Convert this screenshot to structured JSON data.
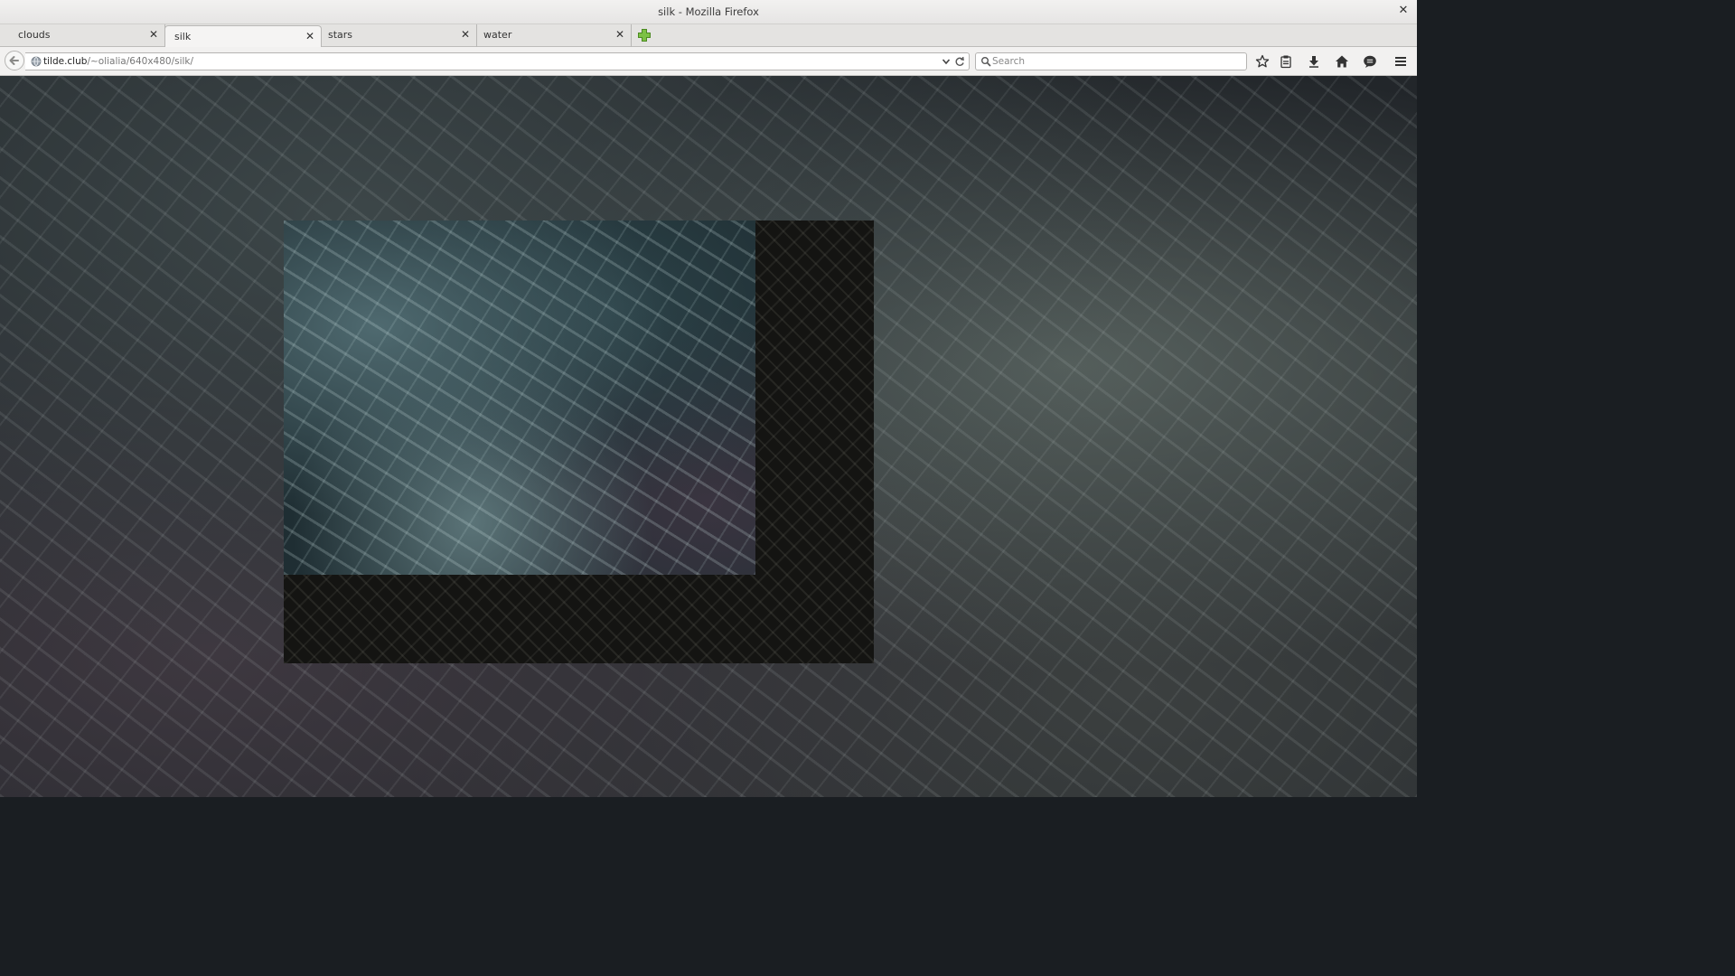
{
  "window": {
    "title": "silk - Mozilla Firefox"
  },
  "tabs": [
    {
      "label": "clouds"
    },
    {
      "label": "silk"
    },
    {
      "label": "stars"
    },
    {
      "label": "water"
    }
  ],
  "toolbar": {
    "url_host": "tilde.club",
    "url_path": "/~olialia/640x480/silk/",
    "search_placeholder": "Search"
  },
  "icons": {
    "back": "back-arrow-icon",
    "new_tab": "plus-icon",
    "bookmark": "star-icon",
    "reading_list": "clipboard-icon",
    "downloads": "download-arrow-icon",
    "home": "home-icon",
    "chat": "chat-bubble-icon",
    "menu": "hamburger-menu-icon"
  },
  "colors": {
    "new_tab_plus": "#6fb23a",
    "content_bg": "#22262a",
    "frame_bg": "#141412"
  }
}
